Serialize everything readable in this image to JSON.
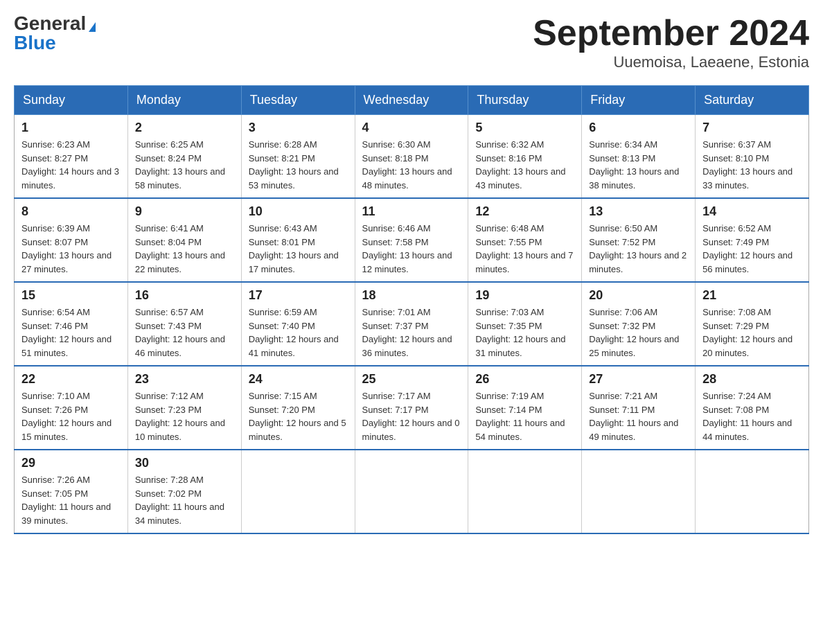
{
  "header": {
    "logo_general": "General",
    "logo_blue": "Blue",
    "title": "September 2024",
    "subtitle": "Uuemoisa, Laeaene, Estonia"
  },
  "calendar": {
    "days_of_week": [
      "Sunday",
      "Monday",
      "Tuesday",
      "Wednesday",
      "Thursday",
      "Friday",
      "Saturday"
    ],
    "weeks": [
      [
        {
          "day": "1",
          "sunrise": "Sunrise: 6:23 AM",
          "sunset": "Sunset: 8:27 PM",
          "daylight": "Daylight: 14 hours and 3 minutes."
        },
        {
          "day": "2",
          "sunrise": "Sunrise: 6:25 AM",
          "sunset": "Sunset: 8:24 PM",
          "daylight": "Daylight: 13 hours and 58 minutes."
        },
        {
          "day": "3",
          "sunrise": "Sunrise: 6:28 AM",
          "sunset": "Sunset: 8:21 PM",
          "daylight": "Daylight: 13 hours and 53 minutes."
        },
        {
          "day": "4",
          "sunrise": "Sunrise: 6:30 AM",
          "sunset": "Sunset: 8:18 PM",
          "daylight": "Daylight: 13 hours and 48 minutes."
        },
        {
          "day": "5",
          "sunrise": "Sunrise: 6:32 AM",
          "sunset": "Sunset: 8:16 PM",
          "daylight": "Daylight: 13 hours and 43 minutes."
        },
        {
          "day": "6",
          "sunrise": "Sunrise: 6:34 AM",
          "sunset": "Sunset: 8:13 PM",
          "daylight": "Daylight: 13 hours and 38 minutes."
        },
        {
          "day": "7",
          "sunrise": "Sunrise: 6:37 AM",
          "sunset": "Sunset: 8:10 PM",
          "daylight": "Daylight: 13 hours and 33 minutes."
        }
      ],
      [
        {
          "day": "8",
          "sunrise": "Sunrise: 6:39 AM",
          "sunset": "Sunset: 8:07 PM",
          "daylight": "Daylight: 13 hours and 27 minutes."
        },
        {
          "day": "9",
          "sunrise": "Sunrise: 6:41 AM",
          "sunset": "Sunset: 8:04 PM",
          "daylight": "Daylight: 13 hours and 22 minutes."
        },
        {
          "day": "10",
          "sunrise": "Sunrise: 6:43 AM",
          "sunset": "Sunset: 8:01 PM",
          "daylight": "Daylight: 13 hours and 17 minutes."
        },
        {
          "day": "11",
          "sunrise": "Sunrise: 6:46 AM",
          "sunset": "Sunset: 7:58 PM",
          "daylight": "Daylight: 13 hours and 12 minutes."
        },
        {
          "day": "12",
          "sunrise": "Sunrise: 6:48 AM",
          "sunset": "Sunset: 7:55 PM",
          "daylight": "Daylight: 13 hours and 7 minutes."
        },
        {
          "day": "13",
          "sunrise": "Sunrise: 6:50 AM",
          "sunset": "Sunset: 7:52 PM",
          "daylight": "Daylight: 13 hours and 2 minutes."
        },
        {
          "day": "14",
          "sunrise": "Sunrise: 6:52 AM",
          "sunset": "Sunset: 7:49 PM",
          "daylight": "Daylight: 12 hours and 56 minutes."
        }
      ],
      [
        {
          "day": "15",
          "sunrise": "Sunrise: 6:54 AM",
          "sunset": "Sunset: 7:46 PM",
          "daylight": "Daylight: 12 hours and 51 minutes."
        },
        {
          "day": "16",
          "sunrise": "Sunrise: 6:57 AM",
          "sunset": "Sunset: 7:43 PM",
          "daylight": "Daylight: 12 hours and 46 minutes."
        },
        {
          "day": "17",
          "sunrise": "Sunrise: 6:59 AM",
          "sunset": "Sunset: 7:40 PM",
          "daylight": "Daylight: 12 hours and 41 minutes."
        },
        {
          "day": "18",
          "sunrise": "Sunrise: 7:01 AM",
          "sunset": "Sunset: 7:37 PM",
          "daylight": "Daylight: 12 hours and 36 minutes."
        },
        {
          "day": "19",
          "sunrise": "Sunrise: 7:03 AM",
          "sunset": "Sunset: 7:35 PM",
          "daylight": "Daylight: 12 hours and 31 minutes."
        },
        {
          "day": "20",
          "sunrise": "Sunrise: 7:06 AM",
          "sunset": "Sunset: 7:32 PM",
          "daylight": "Daylight: 12 hours and 25 minutes."
        },
        {
          "day": "21",
          "sunrise": "Sunrise: 7:08 AM",
          "sunset": "Sunset: 7:29 PM",
          "daylight": "Daylight: 12 hours and 20 minutes."
        }
      ],
      [
        {
          "day": "22",
          "sunrise": "Sunrise: 7:10 AM",
          "sunset": "Sunset: 7:26 PM",
          "daylight": "Daylight: 12 hours and 15 minutes."
        },
        {
          "day": "23",
          "sunrise": "Sunrise: 7:12 AM",
          "sunset": "Sunset: 7:23 PM",
          "daylight": "Daylight: 12 hours and 10 minutes."
        },
        {
          "day": "24",
          "sunrise": "Sunrise: 7:15 AM",
          "sunset": "Sunset: 7:20 PM",
          "daylight": "Daylight: 12 hours and 5 minutes."
        },
        {
          "day": "25",
          "sunrise": "Sunrise: 7:17 AM",
          "sunset": "Sunset: 7:17 PM",
          "daylight": "Daylight: 12 hours and 0 minutes."
        },
        {
          "day": "26",
          "sunrise": "Sunrise: 7:19 AM",
          "sunset": "Sunset: 7:14 PM",
          "daylight": "Daylight: 11 hours and 54 minutes."
        },
        {
          "day": "27",
          "sunrise": "Sunrise: 7:21 AM",
          "sunset": "Sunset: 7:11 PM",
          "daylight": "Daylight: 11 hours and 49 minutes."
        },
        {
          "day": "28",
          "sunrise": "Sunrise: 7:24 AM",
          "sunset": "Sunset: 7:08 PM",
          "daylight": "Daylight: 11 hours and 44 minutes."
        }
      ],
      [
        {
          "day": "29",
          "sunrise": "Sunrise: 7:26 AM",
          "sunset": "Sunset: 7:05 PM",
          "daylight": "Daylight: 11 hours and 39 minutes."
        },
        {
          "day": "30",
          "sunrise": "Sunrise: 7:28 AM",
          "sunset": "Sunset: 7:02 PM",
          "daylight": "Daylight: 11 hours and 34 minutes."
        },
        {
          "day": "",
          "sunrise": "",
          "sunset": "",
          "daylight": ""
        },
        {
          "day": "",
          "sunrise": "",
          "sunset": "",
          "daylight": ""
        },
        {
          "day": "",
          "sunrise": "",
          "sunset": "",
          "daylight": ""
        },
        {
          "day": "",
          "sunrise": "",
          "sunset": "",
          "daylight": ""
        },
        {
          "day": "",
          "sunrise": "",
          "sunset": "",
          "daylight": ""
        }
      ]
    ]
  }
}
